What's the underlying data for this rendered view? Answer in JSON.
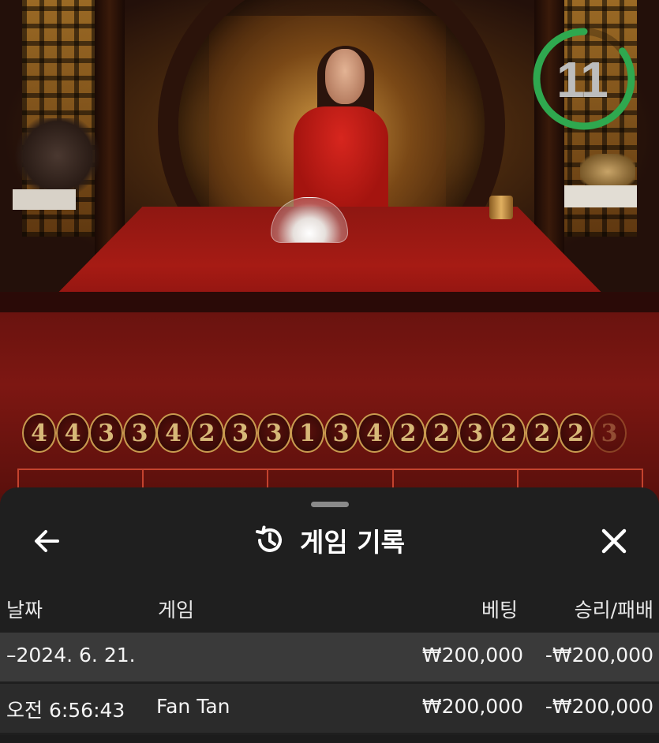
{
  "timer": {
    "value": "11",
    "progress": 0.85,
    "color": "#2fa84f"
  },
  "results": [
    "4",
    "4",
    "3",
    "3",
    "4",
    "2",
    "3",
    "3",
    "1",
    "3",
    "4",
    "2",
    "2",
    "3",
    "2",
    "2",
    "2",
    "3"
  ],
  "panel": {
    "title": "게임 기록",
    "back_icon": "arrow-left-icon",
    "history_icon": "history-icon",
    "close_icon": "close-icon"
  },
  "table": {
    "headers": {
      "date": "날짜",
      "game": "게임",
      "bet": "베팅",
      "winloss": "승리/패배"
    },
    "date_row": {
      "date": "–2024. 6. 21.",
      "bet": "₩200,000",
      "winloss": "-₩200,000"
    },
    "rows": [
      {
        "time": "오전 6:56:43",
        "game": "Fan Tan",
        "bet": "₩200,000",
        "winloss": "-₩200,000"
      }
    ]
  },
  "colors": {
    "panel_bg": "#1f1f1f",
    "date_row_bg": "#3a3a3a",
    "row_bg": "#2b2b2b",
    "timer_ring": "#2fa84f"
  }
}
